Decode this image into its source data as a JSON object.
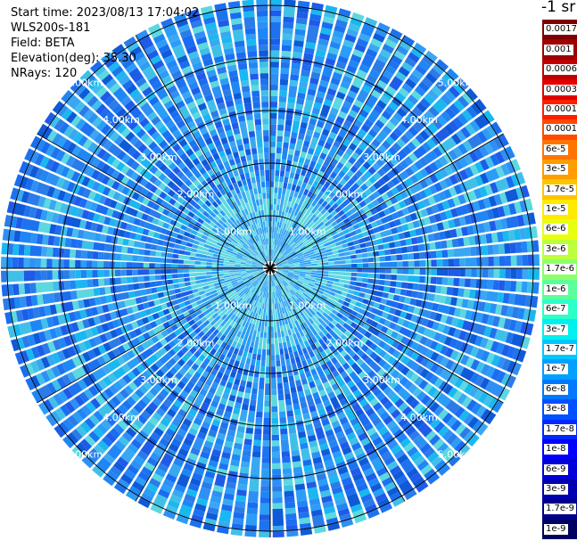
{
  "header": {
    "start_time": "Start time: 2023/08/13 17:04:02",
    "instrument": "WLS200s-181",
    "field": "Field: BETA",
    "elevation": "Elevation(deg): 35.30",
    "nrays": "NRays: 120"
  },
  "colorbar": {
    "unit": "-1 sr",
    "labels": [
      "0.0017",
      "0.001",
      "0.0006",
      "0.0003",
      "0.00017",
      "0.0001",
      "6e-5",
      "3e-5",
      "1.7e-5",
      "1e-5",
      "6e-6",
      "3e-6",
      "1.7e-6",
      "1e-6",
      "6e-7",
      "3e-7",
      "1.7e-7",
      "1e-7",
      "6e-8",
      "3e-8",
      "1.7e-8",
      "1e-8",
      "6e-9",
      "3e-9",
      "1.7e-9",
      "1e-9"
    ],
    "colors": [
      "#7f0000",
      "#9e0000",
      "#c00000",
      "#e00000",
      "#ff1e00",
      "#ff4a00",
      "#ff7400",
      "#ff9c00",
      "#ffc400",
      "#ffea00",
      "#e8ff10",
      "#bcff3a",
      "#8cff6a",
      "#5cff9a",
      "#2cffc8",
      "#00f0f0",
      "#00c8ff",
      "#00a0ff",
      "#0078ff",
      "#0050ff",
      "#0028ff",
      "#0000ff",
      "#0000d8",
      "#0000b0",
      "#000088",
      "#000060"
    ]
  },
  "range_rings": {
    "labels": [
      "1.00km",
      "2.00km",
      "3.00km",
      "4.00km",
      "5.00km"
    ]
  },
  "scan": {
    "palette": [
      "#1a6cf0",
      "#1f86f5",
      "#2a9df7",
      "#3aa7f2",
      "#1e5be8",
      "#2b7be8",
      "#19b8f0",
      "#40c0e8",
      "#1d73ef",
      "#2e90f4",
      "#0e5ad8",
      "#5cd8e0"
    ]
  }
}
